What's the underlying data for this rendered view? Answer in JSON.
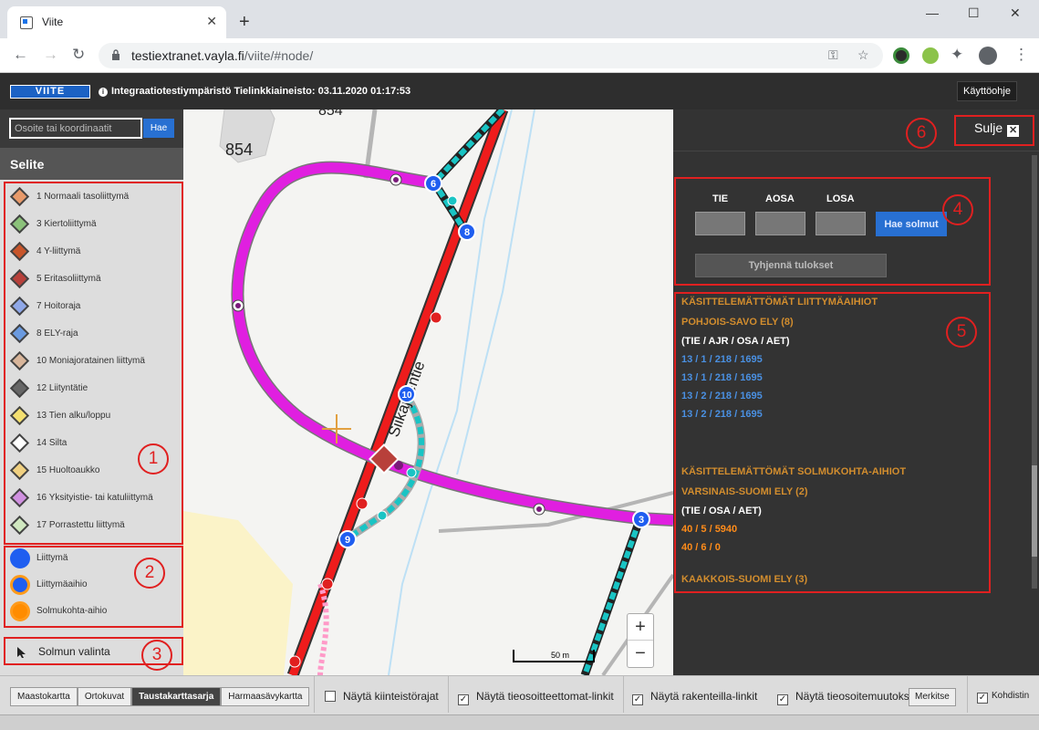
{
  "browser": {
    "tab_title": "Viite",
    "url_host": "testiextranet.vayla.fi",
    "url_path": "/viite/#node/"
  },
  "header": {
    "logo": "VIITE",
    "env_info": "Integraatiotestiympäristö Tielinkkiaineisto: 03.11.2020 01:17:53",
    "help_label": "Käyttöohje"
  },
  "sidebar": {
    "search_placeholder": "Osoite tai koordinaatit",
    "search_button": "Hae",
    "legend_title": "Selite",
    "junction_types": [
      {
        "label": "1 Normaali tasoliittymä",
        "color": "#e89a6a"
      },
      {
        "label": "3 Kiertoliittymä",
        "color": "#8bc27a"
      },
      {
        "label": "4 Y-liittymä",
        "color": "#c8552a"
      },
      {
        "label": "5 Eritasoliittymä",
        "color": "#b8403a"
      },
      {
        "label": "7 Hoitoraja",
        "color": "#8fa8e8"
      },
      {
        "label": "8 ELY-raja",
        "color": "#6a9ae0"
      },
      {
        "label": "10 Moniajoratainen liittymä",
        "color": "#d8b59a"
      },
      {
        "label": "12 Liityntätie",
        "color": "#666666"
      },
      {
        "label": "13 Tien alku/loppu",
        "color": "#f4e070"
      },
      {
        "label": "14 Silta",
        "color": "#ffffff"
      },
      {
        "label": "15 Huoltoaukko",
        "color": "#f0d080"
      },
      {
        "label": "16 Yksityistie- tai katuliittymä",
        "color": "#d090e0"
      },
      {
        "label": "17 Porrastettu liittymä",
        "color": "#d0e8c0"
      }
    ],
    "node_types": [
      {
        "label": "Liittymä",
        "color": "#1f5ef0",
        "ring": "#1f5ef0"
      },
      {
        "label": "Liittymäaihio",
        "color": "#1f5ef0",
        "ring": "#ff9a1a"
      },
      {
        "label": "Solmukohta-aihio",
        "color": "#ff8c00",
        "ring": "#ff9a1a"
      }
    ],
    "node_select_label": "Solmun valinta"
  },
  "map": {
    "labels": [
      "854",
      "854"
    ],
    "road_name": "Siikajoentie",
    "node_numbers": [
      "6",
      "8",
      "10",
      "9",
      "3"
    ],
    "scale_label": "50 m",
    "zoom_in": "+",
    "zoom_out": "−"
  },
  "panel": {
    "close_label": "Sulje",
    "field_labels": [
      "TIE",
      "AOSA",
      "LOSA"
    ],
    "find_button": "Hae solmut",
    "clear_button": "Tyhjennä tulokset",
    "results": {
      "junction_heading": "KÄSITTELEMÄTTÖMÄT LIITTYMÄAIHIOT",
      "junction_ely": "POHJOIS-SAVO ELY (8)",
      "junction_columns": "(TIE / AJR / OSA / AET)",
      "junction_items": [
        "13 / 1 / 218 / 1695",
        "13 / 1 / 218 / 1695",
        "13 / 2 / 218 / 1695",
        "13 / 2 / 218 / 1695"
      ],
      "node_heading": "KÄSITTELEMÄTTÖMÄT SOLMUKOHTA-AIHIOT",
      "node_ely": "VARSINAIS-SUOMI ELY (2)",
      "node_columns": "(TIE / OSA / AET)",
      "node_items": [
        "40 / 5 / 5940",
        "40 / 6 / 0"
      ],
      "next_ely": "KAAKKOIS-SUOMI ELY (3)"
    }
  },
  "annotations": [
    "1",
    "2",
    "3",
    "4",
    "5",
    "6"
  ],
  "bottom": {
    "map_types": [
      {
        "label": "Maastokartta",
        "active": false
      },
      {
        "label": "Ortokuvat",
        "active": false
      },
      {
        "label": "Taustakarttasarja",
        "active": true
      },
      {
        "label": "Harmaasävykartta",
        "active": false
      }
    ],
    "show_property_borders": "Näytä kiinteistörajat",
    "show_unaddressed_links": "Näytä tieosoitteettomat-linkit",
    "show_construction_links": "Näytä rakenteilla-linkit",
    "show_road_address_changes": "Näytä tieosoitemuutokset",
    "merkitse": "Merkitse",
    "kohdistin": "Kohdistin"
  }
}
